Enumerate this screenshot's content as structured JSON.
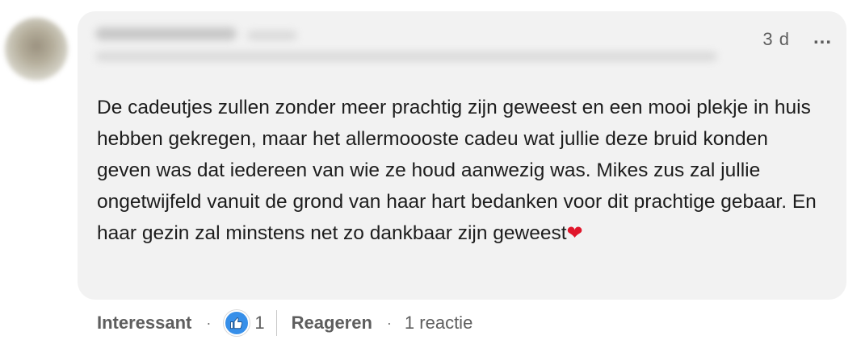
{
  "comment": {
    "timestamp": "3 d",
    "more_label": "...",
    "text": "De cadeutjes zullen zonder meer prachtig zijn geweest en een mooi plekje in huis hebben gekregen, maar het allermoooste cadeu wat jullie deze bruid konden geven was dat iedereen van wie ze houd aanwezig was. Mikes zus zal jullie ongetwijfeld vanuit de grond van haar hart bedanken voor dit prachtige gebaar. En haar gezin zal minstens net zo dankbaar zijn geweest",
    "emoji": "❤"
  },
  "actions": {
    "react_label": "Interessant",
    "separator": "·",
    "reaction_icon": "like-thumb-icon",
    "reaction_count": "1",
    "reply_label": "Reageren",
    "reply_count_label": "1 reactie"
  },
  "colors": {
    "bubble_bg": "#f2f2f2",
    "like_blue": "#378fe9",
    "heart_red": "#e0162b",
    "text": "#1d1d1d",
    "muted": "#5e5e5e"
  }
}
